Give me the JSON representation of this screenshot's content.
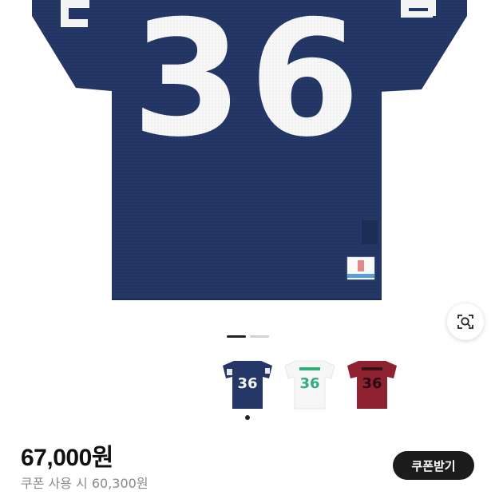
{
  "product": {
    "jersey_number": "36",
    "colors": {
      "navy": "#243766",
      "white": "#f6f6f6",
      "burgundy": "#8f2231",
      "mint": "#2fae7c"
    },
    "thumbnails": [
      {
        "number": "36",
        "color": "navy"
      },
      {
        "number": "36",
        "color": "white"
      },
      {
        "number": "36",
        "color": "burgundy"
      }
    ],
    "carousel": {
      "current": 1,
      "total": 2
    }
  },
  "price": {
    "amount": "67,000원",
    "coupon_line": "쿠폰 사용 시 60,300원"
  },
  "buttons": {
    "coupon_button": "쿠폰받기",
    "lens_icon": "camera-search-icon"
  }
}
